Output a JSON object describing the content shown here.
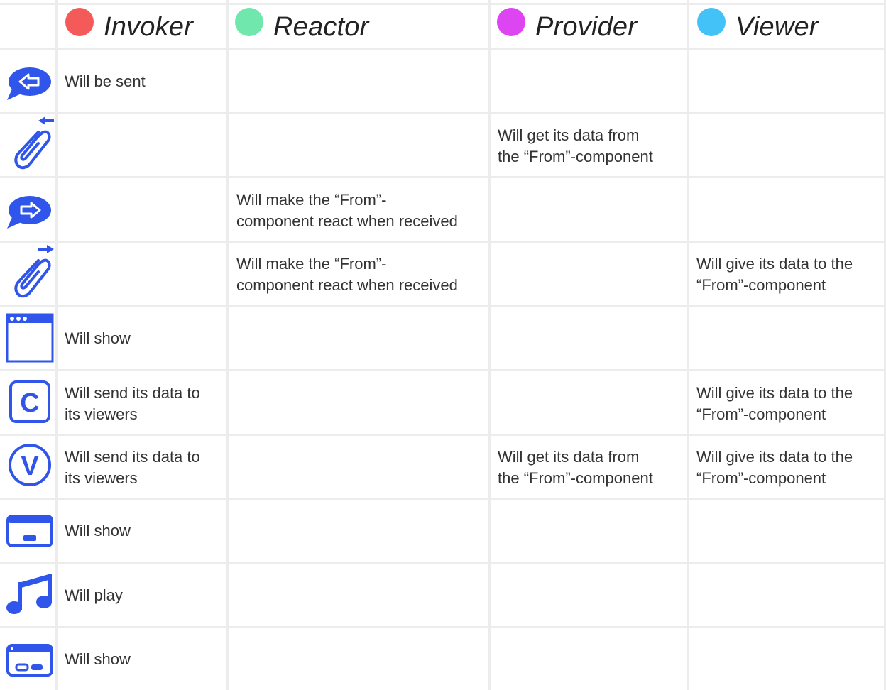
{
  "colors": {
    "icon_blue": "#2f55ea",
    "grid_line": "#ececec"
  },
  "columns": [
    {
      "key": "invoker",
      "label": "Invoker",
      "dot_color": "#f55a5a"
    },
    {
      "key": "reactor",
      "label": "Reactor",
      "dot_color": "#6fe7ad"
    },
    {
      "key": "provider",
      "label": "Provider",
      "dot_color": "#dd44f2"
    },
    {
      "key": "viewer",
      "label": "Viewer",
      "dot_color": "#42c2f7"
    }
  ],
  "rows": [
    {
      "icon": "send-bubble-icon",
      "invoker": "Will be sent",
      "reactor": "",
      "provider": "",
      "viewer": ""
    },
    {
      "icon": "paperclip-in-icon",
      "invoker": "",
      "reactor": "",
      "provider": "Will get its data from\nthe “From”-component",
      "viewer": ""
    },
    {
      "icon": "receive-bubble-icon",
      "invoker": "",
      "reactor": "Will make the “From”-\ncomponent react when received",
      "provider": "",
      "viewer": ""
    },
    {
      "icon": "paperclip-out-icon",
      "invoker": "",
      "reactor": "Will make the “From”-\ncomponent react when received",
      "provider": "",
      "viewer": "Will give its data to the\n“From”-component"
    },
    {
      "icon": "window-icon",
      "invoker": "Will show",
      "reactor": "",
      "provider": "",
      "viewer": ""
    },
    {
      "icon": "c-box-icon",
      "invoker": "Will send its data to\nits viewers",
      "reactor": "",
      "provider": "",
      "viewer": "Will give its data to the\n“From”-component"
    },
    {
      "icon": "v-circle-icon",
      "invoker": "Will send its data to\nits viewers",
      "reactor": "",
      "provider": "Will get its data from\nthe “From”-component",
      "viewer": "Will give its data to the\n“From”-component"
    },
    {
      "icon": "dialog-window-icon",
      "invoker": "Will show",
      "reactor": "",
      "provider": "",
      "viewer": ""
    },
    {
      "icon": "music-note-icon",
      "invoker": "Will play",
      "reactor": "",
      "provider": "",
      "viewer": ""
    },
    {
      "icon": "button-window-icon",
      "invoker": "Will show",
      "reactor": "",
      "provider": "",
      "viewer": ""
    }
  ]
}
